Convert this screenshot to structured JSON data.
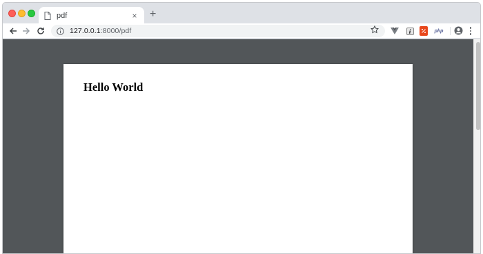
{
  "tab": {
    "title": "pdf",
    "close_glyph": "×",
    "new_tab_glyph": "+"
  },
  "address": {
    "host": "127.0.0.1",
    "port_path": ":8000/pdf"
  },
  "extensions": {
    "php_label": "php"
  },
  "document": {
    "heading": "Hello World"
  },
  "colors": {
    "viewer_bg": "#525659",
    "tab_bar": "#dee1e6",
    "extension_red": "#e8471c"
  },
  "icons": [
    "doc-icon",
    "back-icon",
    "forward-icon",
    "reload-icon",
    "info-icon",
    "star-icon",
    "profile-icon",
    "menu-icon"
  ]
}
